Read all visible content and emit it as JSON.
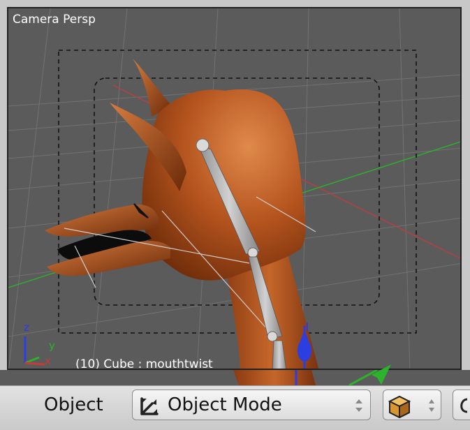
{
  "viewport": {
    "title": "Camera Persp",
    "status": "(10) Cube : mouthtwist",
    "axis_labels": {
      "x": "x",
      "y": "y",
      "z": "z"
    }
  },
  "header": {
    "label": "Object",
    "mode_select": {
      "value": "Object Mode"
    }
  },
  "icons": {
    "mode": "object-mode-icon",
    "shading": "solid-cube-icon",
    "updown": "up-down-arrows-icon",
    "pivot": "pivot-icon"
  },
  "colors": {
    "mesh": "#b5541e",
    "axis_x": "#c83a3a",
    "axis_y": "#2bb32b",
    "axis_z": "#2c3ee0",
    "bone": "#a9a9a9"
  }
}
